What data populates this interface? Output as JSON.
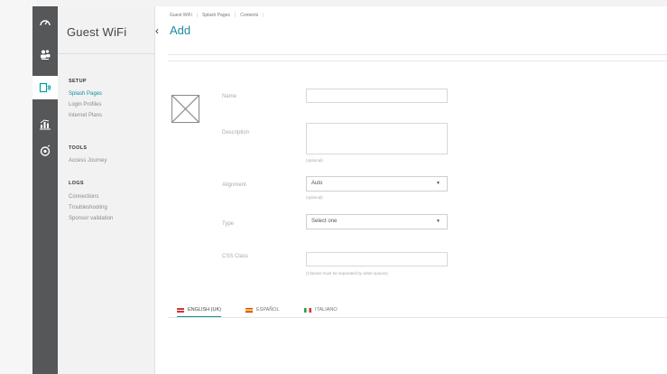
{
  "app": {
    "title": "Guest WiFi"
  },
  "rail": {
    "items": [
      {
        "icon": "dashboard-icon"
      },
      {
        "icon": "users-icon"
      },
      {
        "icon": "guest-wifi-icon",
        "active": true
      },
      {
        "icon": "reports-icon"
      },
      {
        "icon": "settings-icon"
      }
    ]
  },
  "sidebar": {
    "sections": [
      {
        "heading": "SETUP",
        "items": [
          "Splash Pages",
          "Login Profiles",
          "Internet Plans"
        ]
      },
      {
        "heading": "TOOLS",
        "items": [
          "Access Journey"
        ]
      },
      {
        "heading": "LOGS",
        "items": [
          "Connections",
          "Troubleshooting",
          "Sponsor validation"
        ]
      }
    ],
    "active_item": "Splash Pages",
    "collapse_glyph": "‹"
  },
  "breadcrumb": [
    "Guest WiFi",
    "Splash Pages",
    "Contents"
  ],
  "page": {
    "title": "Add"
  },
  "form": {
    "name_label": "Name",
    "name_value": "",
    "description_label": "Description",
    "description_value": "",
    "description_hint": "(optional)",
    "alignment_label": "Alignment",
    "alignment_value": "Auto",
    "alignment_hint": "(optional)",
    "type_label": "Type",
    "type_value": "Select one",
    "css_label": "CSS Class",
    "css_value": "",
    "css_hint": "(Classes must be separated by white spaces)"
  },
  "language_tabs": [
    {
      "label": "ENGLISH (UK)",
      "active": true,
      "flag": [
        "#cf3a3a",
        "#f2f2f2"
      ]
    },
    {
      "label": "ESPAÑOL",
      "active": false,
      "flag": [
        "#d23b2b",
        "#f3c531"
      ]
    },
    {
      "label": "ITALIANO",
      "active": false,
      "flag": [
        "#2e9a4a",
        "#d23b2b"
      ]
    }
  ],
  "colors": {
    "accent": "#1a8c9c",
    "rail": "#555759",
    "sidebar": "#f2f2f2"
  }
}
